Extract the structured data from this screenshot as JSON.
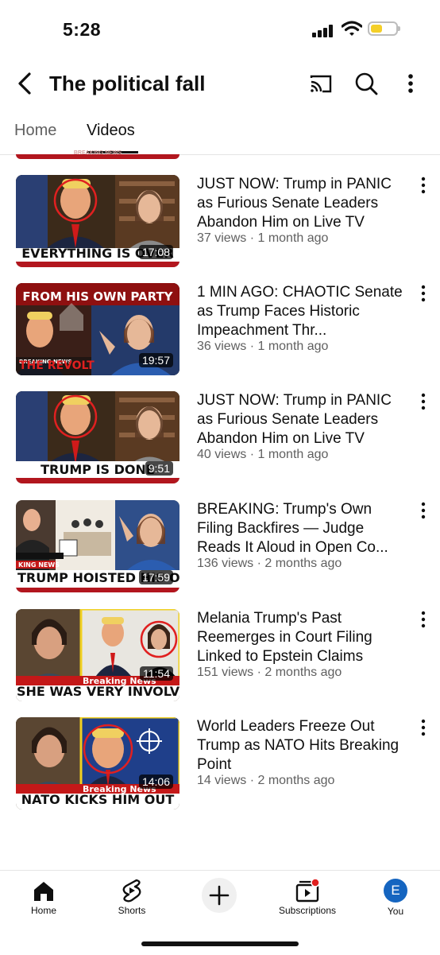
{
  "status_bar": {
    "time": "5:28",
    "battery_color": "#f4cf28"
  },
  "header": {
    "back_icon": "back-arrow-icon",
    "title": "The political fall",
    "icons": [
      "cast-icon",
      "search-icon",
      "more-vert-icon"
    ]
  },
  "tabs": [
    {
      "label": "Home",
      "active": false
    },
    {
      "label": "Videos",
      "active": true
    }
  ],
  "partial_thumb": {
    "banner": "BREAKING NEWS"
  },
  "videos": [
    {
      "title": "JUST NOW: Trump in PANIC as Furious Senate Leaders Abandon Him on Live TV",
      "meta": "37 views · 1 month ago",
      "duration": "17:08",
      "thumb_text": "EVERYTHING IS OVER"
    },
    {
      "title": "1 MIN AGO: CHAOTIC Senate as Trump Faces Historic Impeachment Thr...",
      "meta": "36 views · 1 month ago",
      "duration": "19:57",
      "thumb_text": "FROM HIS OWN PARTY"
    },
    {
      "title": "JUST NOW: Trump in PANIC as Furious Senate Leaders Abandon Him on Live TV",
      "meta": "40 views · 1 month ago",
      "duration": "9:51",
      "thumb_text": "TRUMP IS DONE"
    },
    {
      "title": "BREAKING: Trump's Own Filing Backfires — Judge Reads It Aloud in Open Co...",
      "meta": "136 views · 2 months ago",
      "duration": "17:59",
      "thumb_text": "TRUMP HOISTED HIS OWN"
    },
    {
      "title": "Melania Trump's Past Reemerges in Court Filing Linked to Epstein Claims",
      "meta": "151 views · 2 months ago",
      "duration": "11:54",
      "thumb_text": "SHE WAS VERY INVOLVED!!!"
    },
    {
      "title": "World Leaders Freeze Out Trump as NATO Hits Breaking Point",
      "meta": "14 views · 2 months ago",
      "duration": "14:06",
      "thumb_text": "NATO KICKS HIM OUT"
    }
  ],
  "bottom_nav": {
    "home": "Home",
    "shorts": "Shorts",
    "create_icon": "plus-icon",
    "subscriptions": "Subscriptions",
    "you": "You",
    "avatar_letter": "E"
  }
}
